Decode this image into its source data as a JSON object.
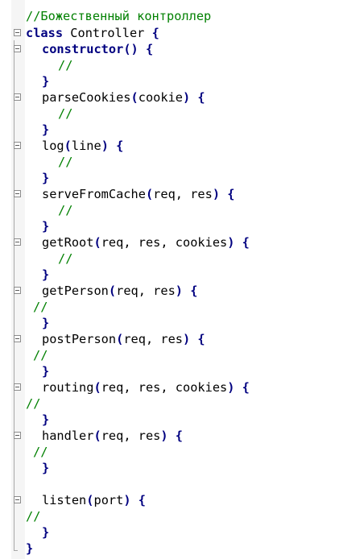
{
  "code": {
    "header_comment": "//Божественный контроллер",
    "class_keyword": "class",
    "class_name": "Controller",
    "open_brace": "{",
    "close_brace": "}",
    "comment": "//",
    "methods": [
      {
        "name": "constructor",
        "params": "",
        "open": "() {"
      },
      {
        "name": "parseCookies",
        "open": "(",
        "params": "cookie",
        "close": ") {"
      },
      {
        "name": "log",
        "open": "(",
        "params": "line",
        "close": ") {"
      },
      {
        "name": "serveFromCache",
        "open": "(",
        "params": "req, res",
        "close": ") {"
      },
      {
        "name": "getRoot",
        "open": "(",
        "params": "req, res, cookies",
        "close": ") {"
      },
      {
        "name": "getPerson",
        "open": "(",
        "params": "req, res",
        "close": ") {"
      },
      {
        "name": "postPerson",
        "open": "(",
        "params": "req, res",
        "close": ") {"
      },
      {
        "name": "routing",
        "open": "(",
        "params": "req, res, cookies",
        "close": ") {"
      },
      {
        "name": "handler",
        "open": "(",
        "params": "req, res",
        "close": ") {"
      },
      {
        "name": "listen",
        "open": "(",
        "params": "port",
        "close": ") {"
      }
    ]
  }
}
